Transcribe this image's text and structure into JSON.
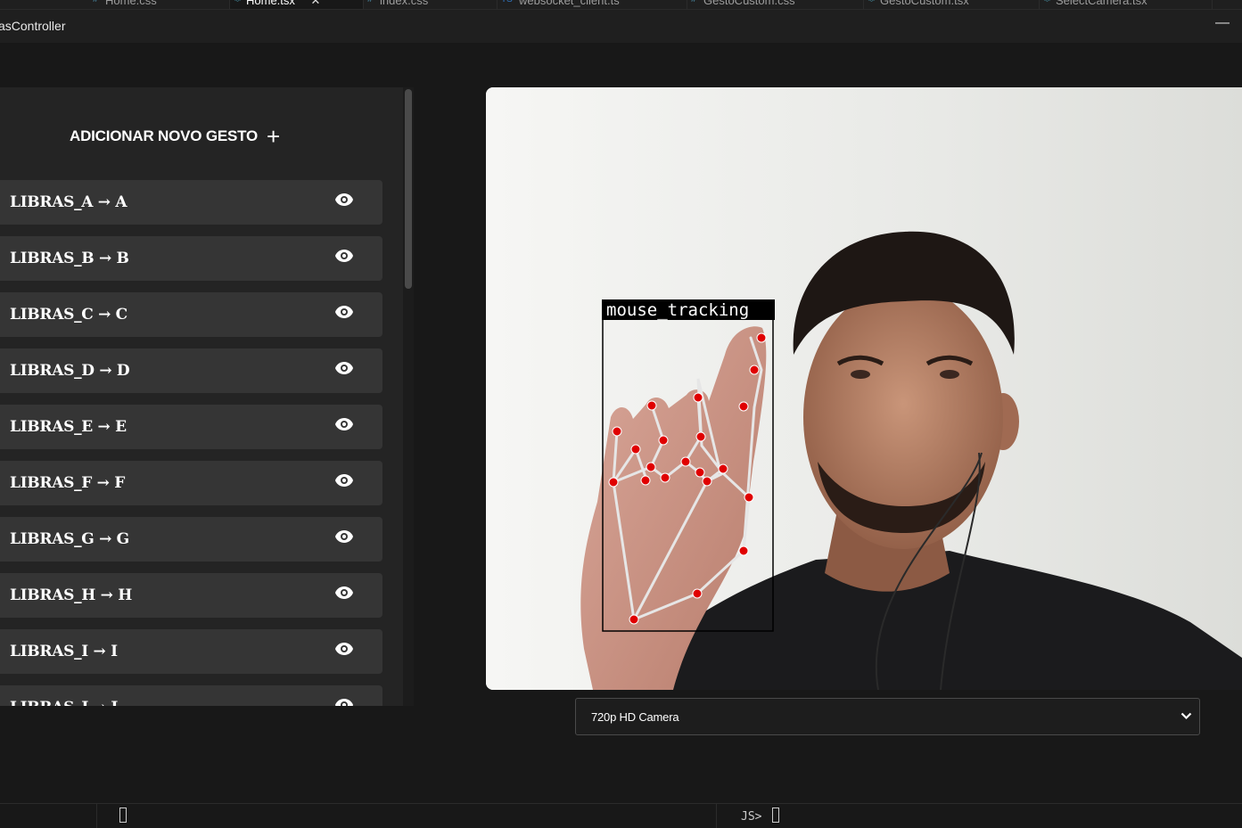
{
  "editor": {
    "tabs": [
      {
        "label": "Home.css",
        "icon": "css-icon"
      },
      {
        "label": "Home.tsx",
        "icon": "react-icon",
        "active": true
      },
      {
        "label": "index.css",
        "icon": "css-icon"
      },
      {
        "label": "websocket_client.ts",
        "icon": "ts-icon"
      },
      {
        "label": "GestoCustom.css",
        "icon": "css-icon"
      },
      {
        "label": "GestoCustom.tsx",
        "icon": "react-icon"
      },
      {
        "label": "SelectCamera.tsx",
        "icon": "react-icon"
      }
    ],
    "close_glyph": "✕"
  },
  "window": {
    "title": "asController",
    "minimize_glyph": "—"
  },
  "panel": {
    "add_button_label": "ADICIONAR NOVO GESTO",
    "add_icon": "+",
    "gestures": [
      {
        "label": "LIBRAS_A → A"
      },
      {
        "label": "LIBRAS_B → B"
      },
      {
        "label": "LIBRAS_C → C"
      },
      {
        "label": "LIBRAS_D → D"
      },
      {
        "label": "LIBRAS_E → E"
      },
      {
        "label": "LIBRAS_F → F"
      },
      {
        "label": "LIBRAS_G → G"
      },
      {
        "label": "LIBRAS_H → H"
      },
      {
        "label": "LIBRAS_I → I"
      },
      {
        "label": "LIBRAS_J → J"
      }
    ],
    "eye_icon": "eye-icon"
  },
  "camera": {
    "overlay_label": "mouse_tracking",
    "device_selected": "720p HD Camera",
    "chevron_icon": "chevron-down-icon"
  },
  "terminal": {
    "prompt": "JS>"
  },
  "colors": {
    "landmark": "#e00000",
    "connection": "#e6e6e6",
    "background": "#181818",
    "panel": "#242424",
    "item": "#353535"
  }
}
